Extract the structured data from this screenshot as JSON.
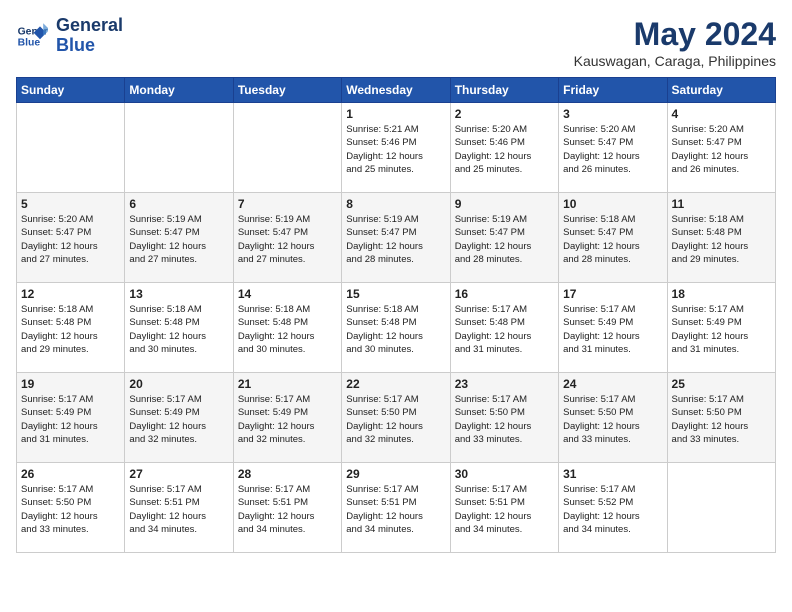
{
  "header": {
    "logo_line1": "General",
    "logo_line2": "Blue",
    "month": "May 2024",
    "location": "Kauswagan, Caraga, Philippines"
  },
  "weekdays": [
    "Sunday",
    "Monday",
    "Tuesday",
    "Wednesday",
    "Thursday",
    "Friday",
    "Saturday"
  ],
  "weeks": [
    [
      {
        "day": "",
        "info": ""
      },
      {
        "day": "",
        "info": ""
      },
      {
        "day": "",
        "info": ""
      },
      {
        "day": "1",
        "info": "Sunrise: 5:21 AM\nSunset: 5:46 PM\nDaylight: 12 hours\nand 25 minutes."
      },
      {
        "day": "2",
        "info": "Sunrise: 5:20 AM\nSunset: 5:46 PM\nDaylight: 12 hours\nand 25 minutes."
      },
      {
        "day": "3",
        "info": "Sunrise: 5:20 AM\nSunset: 5:47 PM\nDaylight: 12 hours\nand 26 minutes."
      },
      {
        "day": "4",
        "info": "Sunrise: 5:20 AM\nSunset: 5:47 PM\nDaylight: 12 hours\nand 26 minutes."
      }
    ],
    [
      {
        "day": "5",
        "info": "Sunrise: 5:20 AM\nSunset: 5:47 PM\nDaylight: 12 hours\nand 27 minutes."
      },
      {
        "day": "6",
        "info": "Sunrise: 5:19 AM\nSunset: 5:47 PM\nDaylight: 12 hours\nand 27 minutes."
      },
      {
        "day": "7",
        "info": "Sunrise: 5:19 AM\nSunset: 5:47 PM\nDaylight: 12 hours\nand 27 minutes."
      },
      {
        "day": "8",
        "info": "Sunrise: 5:19 AM\nSunset: 5:47 PM\nDaylight: 12 hours\nand 28 minutes."
      },
      {
        "day": "9",
        "info": "Sunrise: 5:19 AM\nSunset: 5:47 PM\nDaylight: 12 hours\nand 28 minutes."
      },
      {
        "day": "10",
        "info": "Sunrise: 5:18 AM\nSunset: 5:47 PM\nDaylight: 12 hours\nand 28 minutes."
      },
      {
        "day": "11",
        "info": "Sunrise: 5:18 AM\nSunset: 5:48 PM\nDaylight: 12 hours\nand 29 minutes."
      }
    ],
    [
      {
        "day": "12",
        "info": "Sunrise: 5:18 AM\nSunset: 5:48 PM\nDaylight: 12 hours\nand 29 minutes."
      },
      {
        "day": "13",
        "info": "Sunrise: 5:18 AM\nSunset: 5:48 PM\nDaylight: 12 hours\nand 30 minutes."
      },
      {
        "day": "14",
        "info": "Sunrise: 5:18 AM\nSunset: 5:48 PM\nDaylight: 12 hours\nand 30 minutes."
      },
      {
        "day": "15",
        "info": "Sunrise: 5:18 AM\nSunset: 5:48 PM\nDaylight: 12 hours\nand 30 minutes."
      },
      {
        "day": "16",
        "info": "Sunrise: 5:17 AM\nSunset: 5:48 PM\nDaylight: 12 hours\nand 31 minutes."
      },
      {
        "day": "17",
        "info": "Sunrise: 5:17 AM\nSunset: 5:49 PM\nDaylight: 12 hours\nand 31 minutes."
      },
      {
        "day": "18",
        "info": "Sunrise: 5:17 AM\nSunset: 5:49 PM\nDaylight: 12 hours\nand 31 minutes."
      }
    ],
    [
      {
        "day": "19",
        "info": "Sunrise: 5:17 AM\nSunset: 5:49 PM\nDaylight: 12 hours\nand 31 minutes."
      },
      {
        "day": "20",
        "info": "Sunrise: 5:17 AM\nSunset: 5:49 PM\nDaylight: 12 hours\nand 32 minutes."
      },
      {
        "day": "21",
        "info": "Sunrise: 5:17 AM\nSunset: 5:49 PM\nDaylight: 12 hours\nand 32 minutes."
      },
      {
        "day": "22",
        "info": "Sunrise: 5:17 AM\nSunset: 5:50 PM\nDaylight: 12 hours\nand 32 minutes."
      },
      {
        "day": "23",
        "info": "Sunrise: 5:17 AM\nSunset: 5:50 PM\nDaylight: 12 hours\nand 33 minutes."
      },
      {
        "day": "24",
        "info": "Sunrise: 5:17 AM\nSunset: 5:50 PM\nDaylight: 12 hours\nand 33 minutes."
      },
      {
        "day": "25",
        "info": "Sunrise: 5:17 AM\nSunset: 5:50 PM\nDaylight: 12 hours\nand 33 minutes."
      }
    ],
    [
      {
        "day": "26",
        "info": "Sunrise: 5:17 AM\nSunset: 5:50 PM\nDaylight: 12 hours\nand 33 minutes."
      },
      {
        "day": "27",
        "info": "Sunrise: 5:17 AM\nSunset: 5:51 PM\nDaylight: 12 hours\nand 34 minutes."
      },
      {
        "day": "28",
        "info": "Sunrise: 5:17 AM\nSunset: 5:51 PM\nDaylight: 12 hours\nand 34 minutes."
      },
      {
        "day": "29",
        "info": "Sunrise: 5:17 AM\nSunset: 5:51 PM\nDaylight: 12 hours\nand 34 minutes."
      },
      {
        "day": "30",
        "info": "Sunrise: 5:17 AM\nSunset: 5:51 PM\nDaylight: 12 hours\nand 34 minutes."
      },
      {
        "day": "31",
        "info": "Sunrise: 5:17 AM\nSunset: 5:52 PM\nDaylight: 12 hours\nand 34 minutes."
      },
      {
        "day": "",
        "info": ""
      }
    ]
  ]
}
